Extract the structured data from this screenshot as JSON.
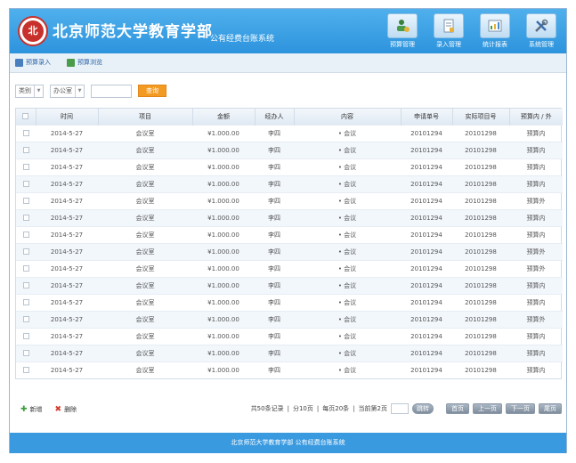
{
  "header": {
    "logo_text": "北",
    "school_name": "北京师范大学教育学部",
    "system_name": "公有经费台账系统",
    "nav": [
      {
        "label": "预算管理",
        "icon": "user-money-icon"
      },
      {
        "label": "录入管理",
        "icon": "document-icon"
      },
      {
        "label": "统计报表",
        "icon": "report-icon"
      },
      {
        "label": "系统管理",
        "icon": "tools-icon"
      }
    ]
  },
  "tabs": [
    {
      "label": "预算录入",
      "icon": "edit-icon"
    },
    {
      "label": "预算浏览",
      "icon": "browse-icon"
    }
  ],
  "filter": {
    "category": "类别",
    "office": "办公室",
    "search_label": "查询"
  },
  "table": {
    "columns": [
      "时间",
      "项目",
      "金额",
      "经办人",
      "内容",
      "申请单号",
      "实际项目号",
      "预算内 / 外"
    ],
    "rows": [
      {
        "date": "2014-5-27",
        "project": "会议室",
        "amount": "¥1.000.00",
        "handler": "李四",
        "content": "• 会议",
        "apply_no": "20101294",
        "project_no": "20101298",
        "budget": "预算内"
      },
      {
        "date": "2014-5-27",
        "project": "会议室",
        "amount": "¥1.000.00",
        "handler": "李四",
        "content": "• 会议",
        "apply_no": "20101294",
        "project_no": "20101298",
        "budget": "预算内"
      },
      {
        "date": "2014-5-27",
        "project": "会议室",
        "amount": "¥1.000.00",
        "handler": "李四",
        "content": "• 会议",
        "apply_no": "20101294",
        "project_no": "20101298",
        "budget": "预算内"
      },
      {
        "date": "2014-5-27",
        "project": "会议室",
        "amount": "¥1.000.00",
        "handler": "李四",
        "content": "• 会议",
        "apply_no": "20101294",
        "project_no": "20101298",
        "budget": "预算内"
      },
      {
        "date": "2014-5-27",
        "project": "会议室",
        "amount": "¥1.000.00",
        "handler": "李四",
        "content": "• 会议",
        "apply_no": "20101294",
        "project_no": "20101298",
        "budget": "预算外"
      },
      {
        "date": "2014-5-27",
        "project": "会议室",
        "amount": "¥1.000.00",
        "handler": "李四",
        "content": "• 会议",
        "apply_no": "20101294",
        "project_no": "20101298",
        "budget": "预算内"
      },
      {
        "date": "2014-5-27",
        "project": "会议室",
        "amount": "¥1.000.00",
        "handler": "李四",
        "content": "• 会议",
        "apply_no": "20101294",
        "project_no": "20101298",
        "budget": "预算内"
      },
      {
        "date": "2014-5-27",
        "project": "会议室",
        "amount": "¥1.000.00",
        "handler": "李四",
        "content": "• 会议",
        "apply_no": "20101294",
        "project_no": "20101298",
        "budget": "预算外"
      },
      {
        "date": "2014-5-27",
        "project": "会议室",
        "amount": "¥1.000.00",
        "handler": "李四",
        "content": "• 会议",
        "apply_no": "20101294",
        "project_no": "20101298",
        "budget": "预算外"
      },
      {
        "date": "2014-5-27",
        "project": "会议室",
        "amount": "¥1.000.00",
        "handler": "李四",
        "content": "• 会议",
        "apply_no": "20101294",
        "project_no": "20101298",
        "budget": "预算内"
      },
      {
        "date": "2014-5-27",
        "project": "会议室",
        "amount": "¥1.000.00",
        "handler": "李四",
        "content": "• 会议",
        "apply_no": "20101294",
        "project_no": "20101298",
        "budget": "预算内"
      },
      {
        "date": "2014-5-27",
        "project": "会议室",
        "amount": "¥1.000.00",
        "handler": "李四",
        "content": "• 会议",
        "apply_no": "20101294",
        "project_no": "20101298",
        "budget": "预算外"
      },
      {
        "date": "2014-5-27",
        "project": "会议室",
        "amount": "¥1.000.00",
        "handler": "李四",
        "content": "• 会议",
        "apply_no": "20101294",
        "project_no": "20101298",
        "budget": "预算内"
      },
      {
        "date": "2014-5-27",
        "project": "会议室",
        "amount": "¥1.000.00",
        "handler": "李四",
        "content": "• 会议",
        "apply_no": "20101294",
        "project_no": "20101298",
        "budget": "预算内"
      },
      {
        "date": "2014-5-27",
        "project": "会议室",
        "amount": "¥1.000.00",
        "handler": "李四",
        "content": "• 会议",
        "apply_no": "20101294",
        "project_no": "20101298",
        "budget": "预算内"
      }
    ]
  },
  "actions": {
    "add_label": "新增",
    "delete_label": "删除"
  },
  "pager": {
    "total": "共50条记录",
    "pages": "分10页",
    "per_page": "每页20条",
    "current": "当前第2页",
    "jump": "跳转",
    "first": "首页",
    "prev": "上一页",
    "next": "下一页",
    "last": "尾页"
  },
  "footer": {
    "copyright": "北京师范大学教育学部 公有经费台账系统"
  },
  "colors": {
    "header": "#2d93dd",
    "accent": "#f39a22",
    "footer": "#3a9ae0"
  }
}
